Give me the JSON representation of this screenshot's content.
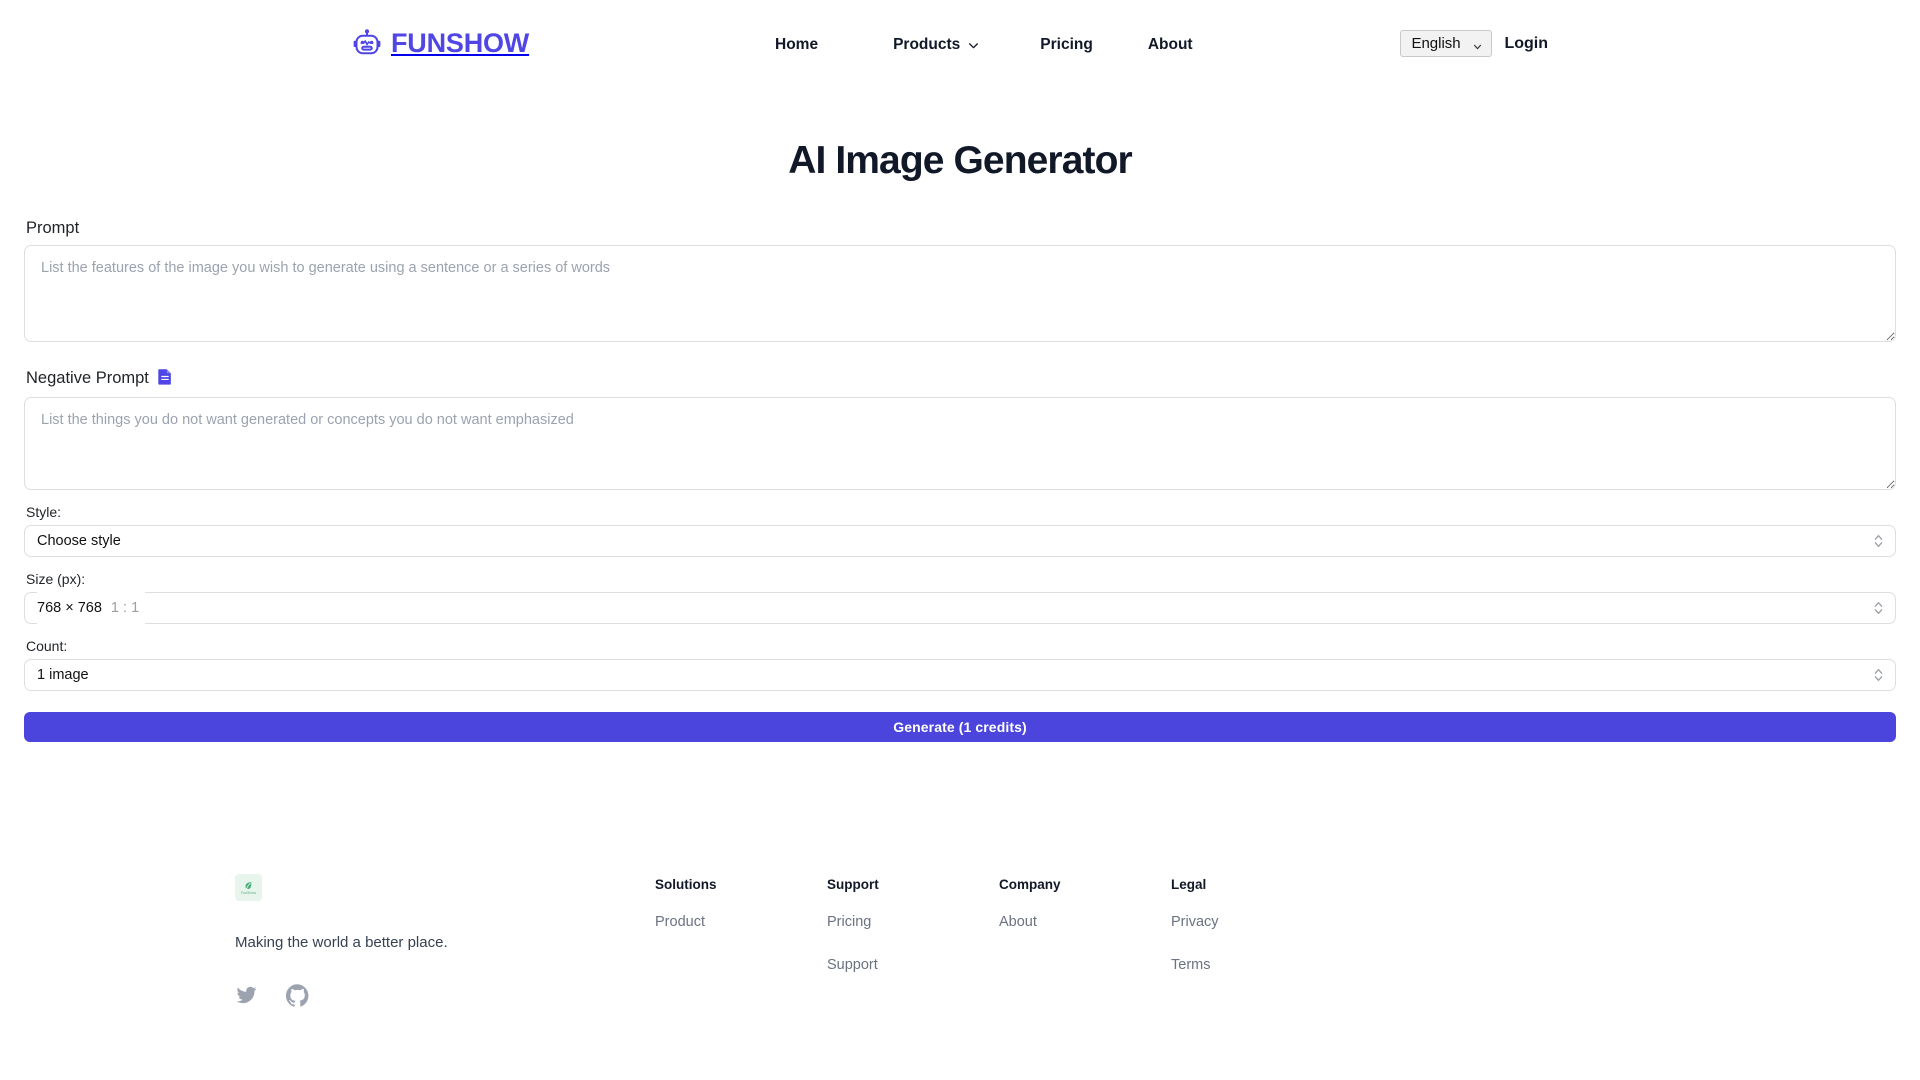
{
  "header": {
    "brand": "FUNSHOW",
    "brand_icon": "robot-icon",
    "nav": [
      {
        "label": "Home",
        "has_caret": false
      },
      {
        "label": "Products",
        "has_caret": true
      },
      {
        "label": "Pricing",
        "has_caret": false
      },
      {
        "label": "About",
        "has_caret": false
      }
    ],
    "language": {
      "selected": "English",
      "options": [
        "English"
      ]
    },
    "login_label": "Login"
  },
  "main": {
    "title": "AI Image Generator",
    "prompt": {
      "label": "Prompt",
      "placeholder": "List the features of the image you wish to generate using a sentence or a series of words",
      "value": ""
    },
    "negative_prompt": {
      "label": "Negative Prompt",
      "icon": "document-icon",
      "placeholder": "List the things you do not want generated or concepts you do not want emphasized",
      "value": ""
    },
    "style": {
      "label": "Style:",
      "selected": "    Choose style",
      "options": [
        "    Choose style"
      ]
    },
    "size": {
      "label": "Size (px):",
      "selected_size": "768 × 768",
      "selected_ratio": "1 : 1",
      "options": [
        "768 × 768  1 : 1"
      ]
    },
    "count": {
      "label": "Count:",
      "selected": "1 image",
      "options": [
        "1 image"
      ]
    },
    "generate_label": "Generate (1 credits)"
  },
  "footer": {
    "logo_text": "FunShow",
    "tagline": "Making the world a better place.",
    "socials": [
      "twitter-icon",
      "github-icon"
    ],
    "columns": [
      {
        "title": "Solutions",
        "links": [
          "Product"
        ]
      },
      {
        "title": "Support",
        "links": [
          "Pricing",
          "Support"
        ]
      },
      {
        "title": "Company",
        "links": [
          "About"
        ]
      },
      {
        "title": "Legal",
        "links": [
          "Privacy",
          "Terms"
        ]
      }
    ]
  },
  "colors": {
    "brand": "#4f46e5",
    "button": "#4b44dd",
    "title": "#111827",
    "muted": "#6b7280",
    "footer_logo_bg": "#e8f5ec"
  }
}
